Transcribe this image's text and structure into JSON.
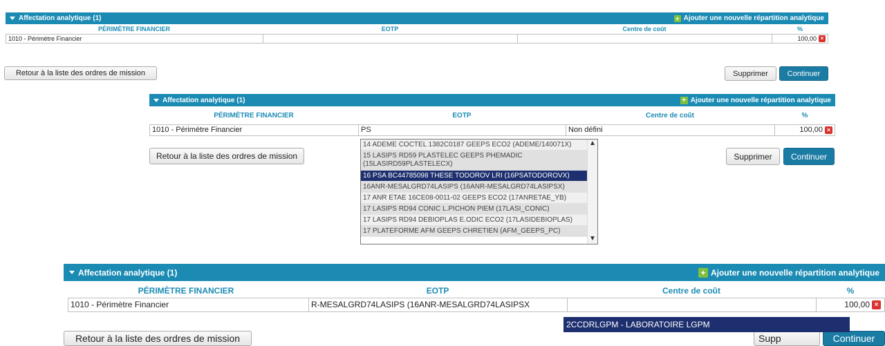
{
  "panel1": {
    "title": "Affectation analytique (1)",
    "add_label": "Ajouter une nouvelle répartition analytique",
    "headers": [
      "PÉRIMÈTRE FINANCIER",
      "EOTP",
      "Centre de coût",
      "%"
    ],
    "row": {
      "perimetre": "1010 - Périmètre Financier",
      "eotp": "",
      "centre": "",
      "pct": "100,00"
    },
    "back_label": "Retour à la liste des ordres de mission",
    "delete_label": "Supprimer",
    "continue_label": "Continuer"
  },
  "panel2": {
    "title": "Affectation analytique (1)",
    "add_label": "Ajouter une nouvelle répartition analytique",
    "headers": [
      "PÉRIMÈTRE FINANCIER",
      "EOTP",
      "Centre de coût",
      "%"
    ],
    "row": {
      "perimetre": "1010 - Périmètre Financier",
      "eotp": "PS",
      "centre": "Non défini",
      "pct": "100,00"
    },
    "back_label": "Retour à la liste des ordres de mission",
    "delete_label": "Supprimer",
    "continue_label": "Continuer",
    "dropdown": [
      "14 ADEME COCTEL 1382C0187 GEEPS ECO2 (ADEME/140071X)",
      "15 LASIPS RD59 PLASTELEC GEEPS PHEMADIC",
      "(15LASIRD59PLASTELECX)",
      "16 PSA BC44785098 THESE TODOROV LRI (16PSATODOROVX)",
      "16ANR-MESALGRD74LASIPS (16ANR-MESALGRD74LASIPSX)",
      "17 ANR ETAE 16CE08-0011-02 GEEPS ECO2 (17ANRETAE_YB)",
      "17 LASIPS RD94 CONIC L.PICHON PIEM (17LASI_CONIC)",
      "17 LASIPS RD94 DEBIOPLAS E.ODIC ECO2 (17LASIDEBIOPLAS)",
      "17 PLATEFORME AFM GEEPS CHRETIEN (AFM_GEEPS_PC)"
    ]
  },
  "panel3": {
    "title": "Affectation analytique (1)",
    "add_label": "Ajouter une nouvelle répartition analytique",
    "headers": [
      "PÉRIMÈTRE FINANCIER",
      "EOTP",
      "Centre de coût",
      "%"
    ],
    "row": {
      "perimetre": "1010 - Périmètre Financier",
      "eotp": "R-MESALGRD74LASIPS (16ANR-MESALGRD74LASIPSX",
      "centre": "",
      "pct": "100,00"
    },
    "suggestion": "2CCDRLGPM - LABORATOIRE LGPM",
    "back_label": "Retour à la liste des ordres de mission",
    "delete_label": "Supp",
    "continue_label": "Continuer"
  }
}
